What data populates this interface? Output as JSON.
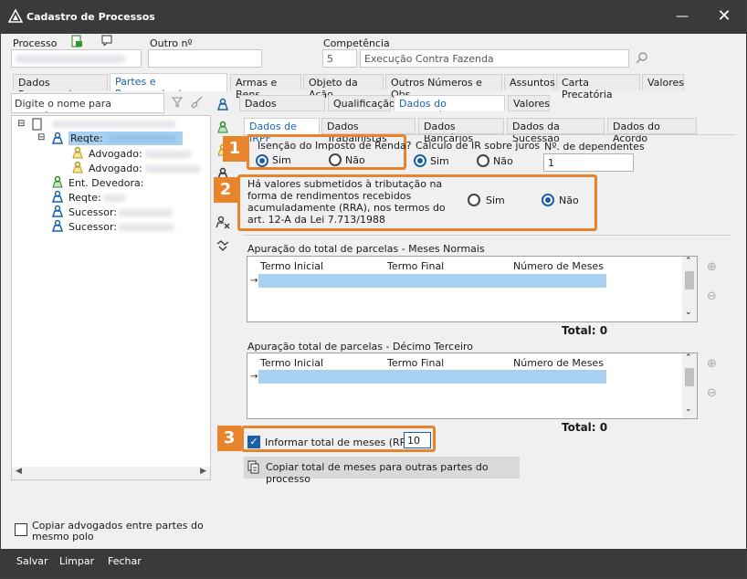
{
  "window": {
    "title": "Cadastro de Processos"
  },
  "header": {
    "processo_label": "Processo",
    "outro_label": "Outro nº",
    "competencia_label": "Competência",
    "competencia_code": "5",
    "competencia_value": "Execução Contra Fazenda"
  },
  "main_tabs": [
    "Dados Processuais",
    "Partes e Representantes",
    "Armas e Bens",
    "Objeto da Ação",
    "Outros Números e Obs.",
    "Assuntos",
    "Carta Precatória",
    "Valores"
  ],
  "left": {
    "search_placeholder": "Digite o nome para pesquisa...",
    "tree": {
      "reqte": "Reqte:",
      "advogado": "Advogado:",
      "ent_devedora": "Ent. Devedora:",
      "sucessor": "Sucessor:"
    },
    "copy_checkbox": "Copiar advogados entre partes do mesmo polo"
  },
  "sub_tabs": [
    "Dados principais",
    "Qualificação",
    "Dados do requisitório",
    "Valores"
  ],
  "sub_tabs2": [
    "Dados de IRPF",
    "Dados Trabalhistas",
    "Dados Bancários",
    "Dados da Sucessão",
    "Dados do Acordo"
  ],
  "irpf": {
    "badge1": "1",
    "badge2": "2",
    "badge3": "3",
    "isencao_label": "Isenção do Imposto de Renda?",
    "sim": "Sim",
    "nao": "Não",
    "calculo_label": "Cálculo de IR sobre juros",
    "dependentes_label": "Nº. de dependentes",
    "dependentes_value": "1",
    "rra_question": "Há valores submetidos à tributação na forma de rendimentos recebidos acumuladamente (RRA), nos termos do art. 12-A da Lei 7.713/1988",
    "grid1_title": "Apuração do total de parcelas - Meses Normais",
    "grid2_title": "Apuração total de parcelas - Décimo Terceiro",
    "col_termo_inicial": "Termo Inicial",
    "col_termo_final": "Termo Final",
    "col_numero_meses": "Número de Meses",
    "total_label": "Total: 0",
    "informar_label": "Informar total de meses (RRA)",
    "informar_value": "10",
    "copiar_button": "Copiar total de meses para outras partes do processo"
  },
  "footer": {
    "salvar": "Salvar",
    "limpar": "Limpar",
    "fechar": "Fechar"
  }
}
